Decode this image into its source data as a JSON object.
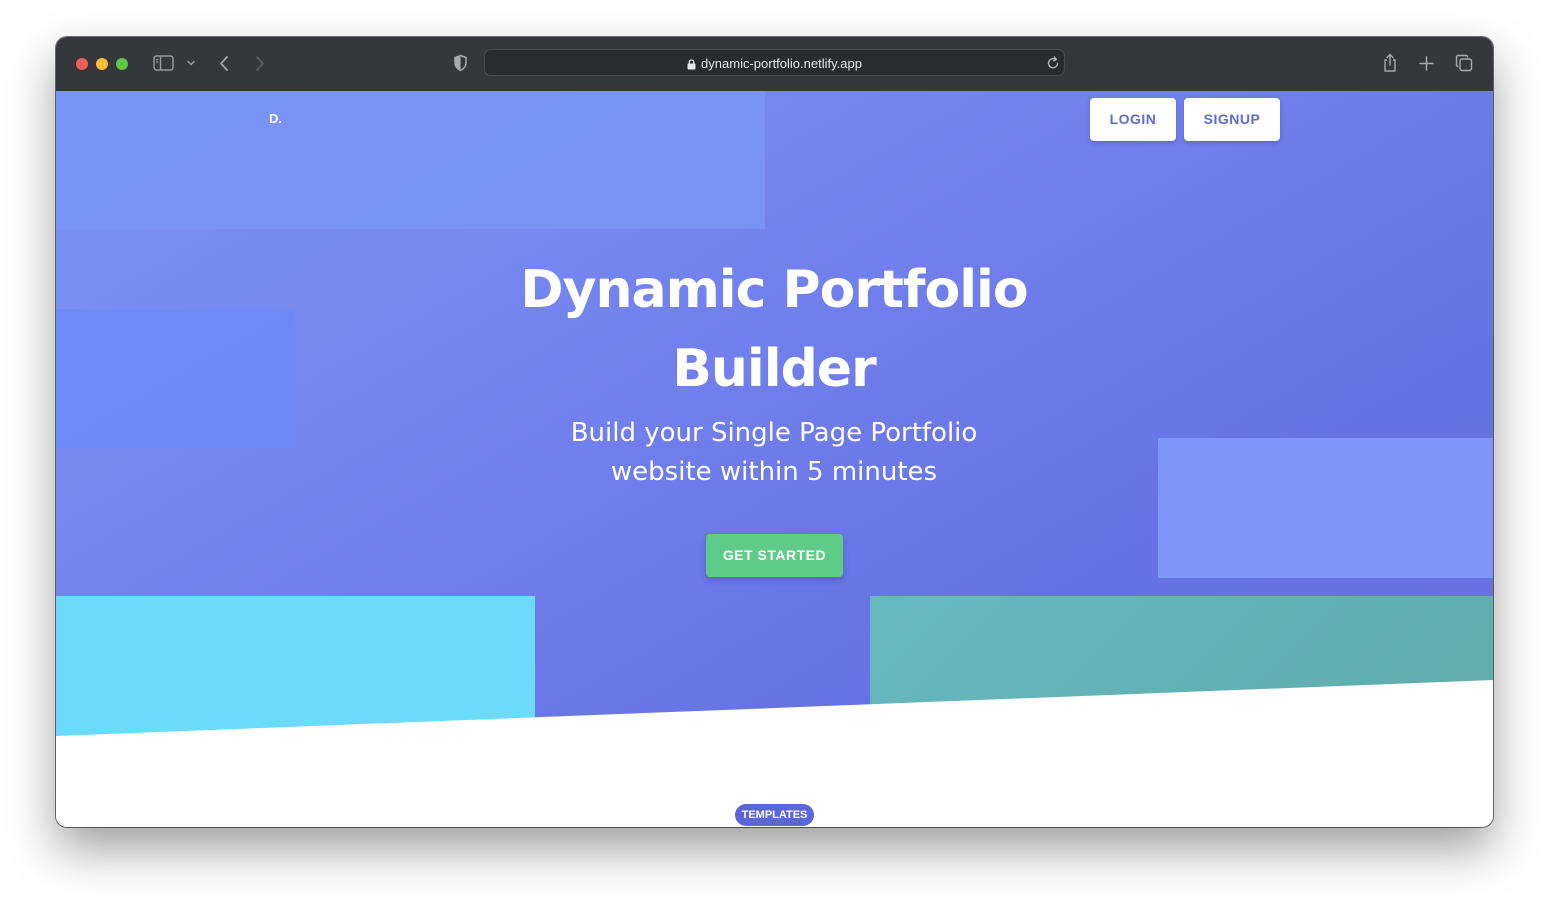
{
  "browser": {
    "url": "dynamic-portfolio.netlify.app",
    "traffic_lights": {
      "close": "#ed5f57",
      "minimize": "#f6be3b",
      "zoom": "#5cc843"
    }
  },
  "navbar": {
    "logo": "D.",
    "login_label": "LOGIN",
    "signup_label": "SIGNUP"
  },
  "hero": {
    "title_line1": "Dynamic Portfolio",
    "title_line2": "Builder",
    "subtitle_line1": "Build your Single Page Portfolio",
    "subtitle_line2": "website within 5 minutes",
    "cta_label": "GET STARTED"
  },
  "section": {
    "badge": "TEMPLATES"
  },
  "colors": {
    "hero_gradient_start": "#7b95f5",
    "hero_gradient_end": "#6672e3",
    "accent_blue": "#5e6ad8",
    "cta_green": "#5ecb88",
    "cyan_block": "#6bdafb",
    "teal_block": "#63b3b8"
  }
}
